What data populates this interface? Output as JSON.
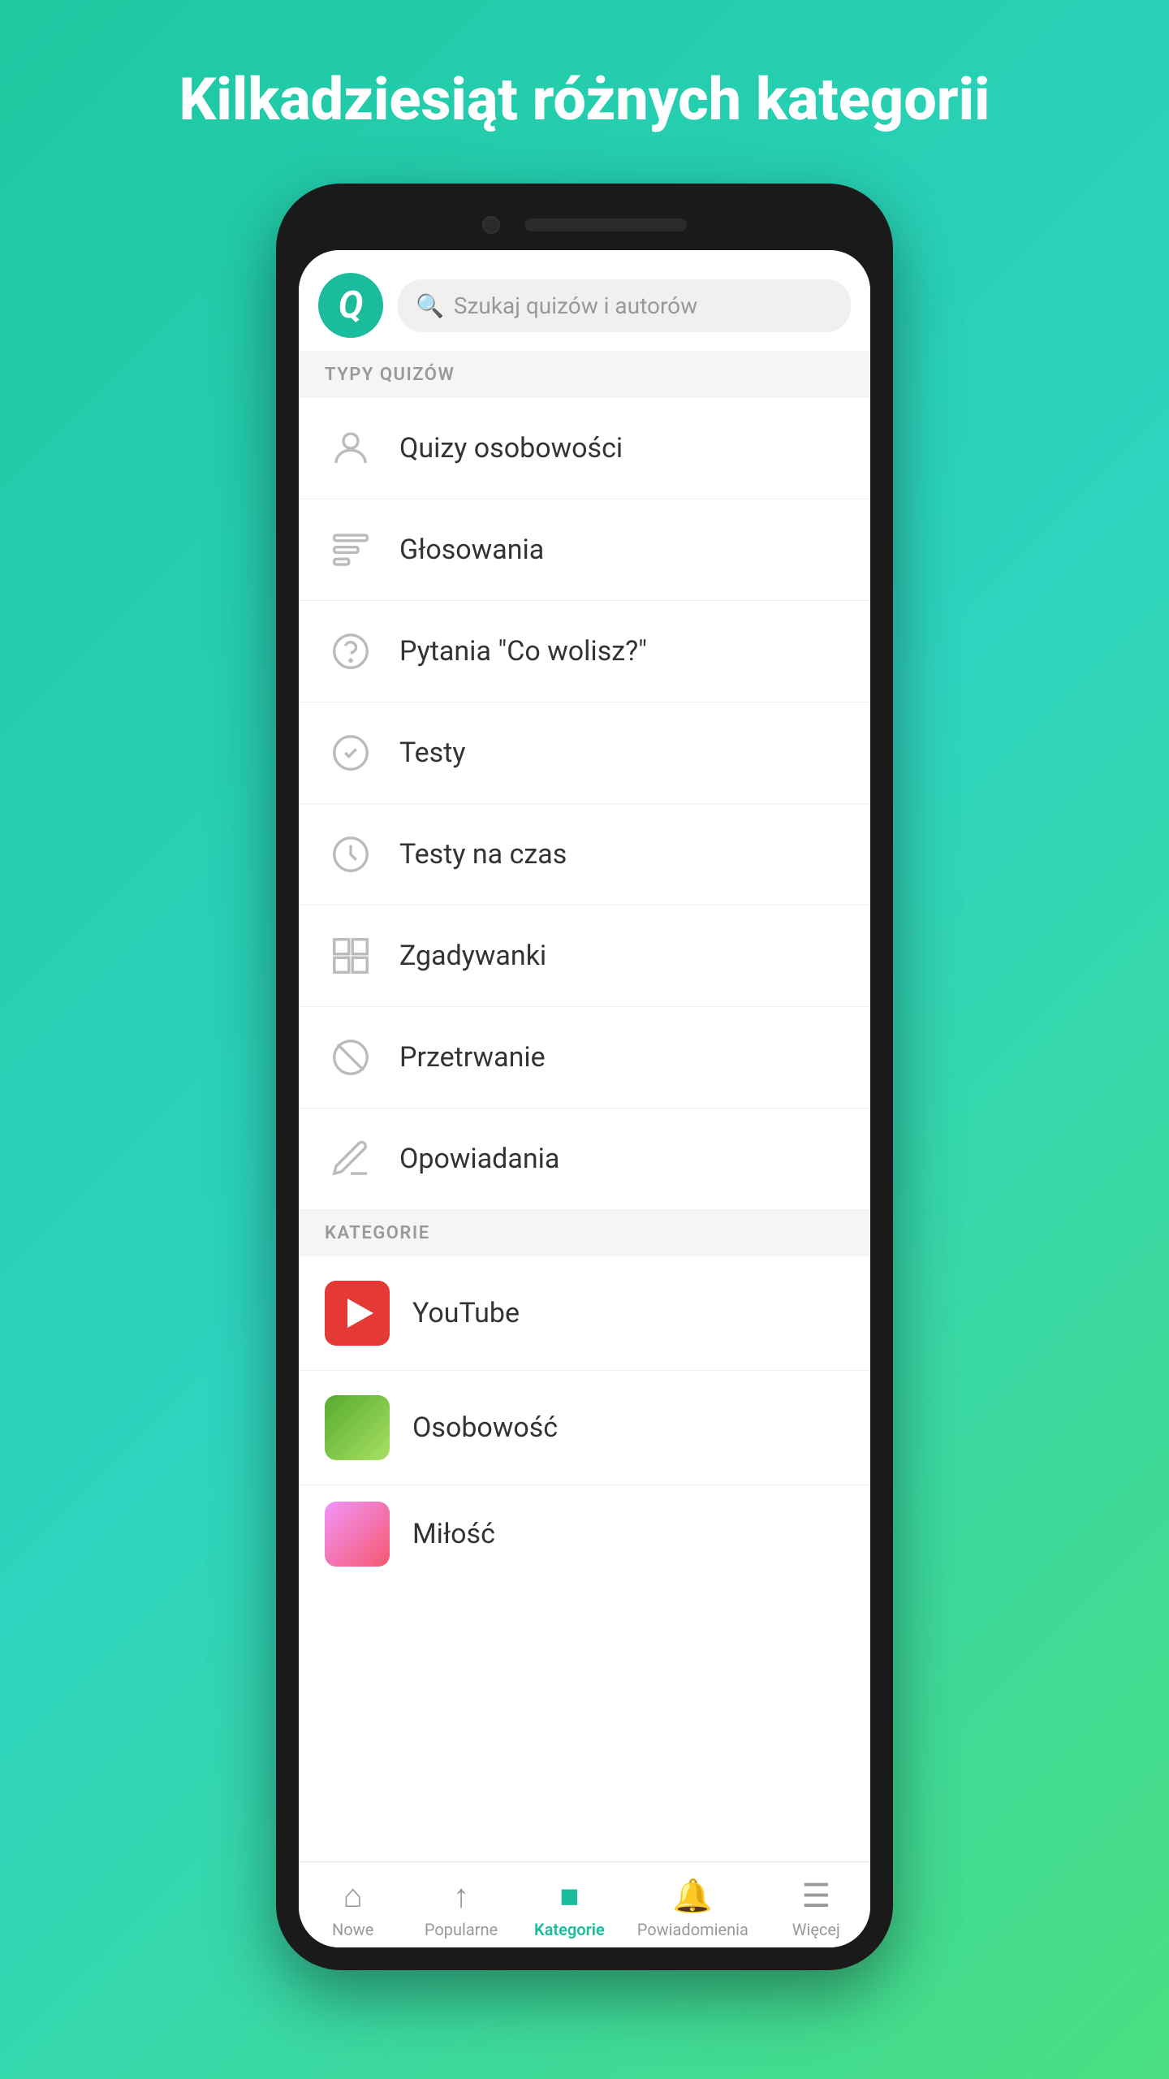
{
  "header": {
    "title": "Kilkadziesiąt różnych kategorii"
  },
  "app": {
    "logo_letter": "Q",
    "search_placeholder": "Szukaj quizów i autorów"
  },
  "sections": {
    "quiz_types": {
      "label": "TYPY QUIZÓW",
      "items": [
        {
          "id": "osobowosci",
          "label": "Quizy osobowości",
          "icon": "person"
        },
        {
          "id": "glosowania",
          "label": "Głosowania",
          "icon": "poll"
        },
        {
          "id": "co-wolisz",
          "label": "Pytania \"Co wolisz?\"",
          "icon": "question"
        },
        {
          "id": "testy",
          "label": "Testy",
          "icon": "checkmark"
        },
        {
          "id": "testy-czas",
          "label": "Testy na czas",
          "icon": "clock"
        },
        {
          "id": "zgadywanki",
          "label": "Zgadywanki",
          "icon": "grid"
        },
        {
          "id": "przetrwanie",
          "label": "Przetrwanie",
          "icon": "ban"
        },
        {
          "id": "opowiadania",
          "label": "Opowiadania",
          "icon": "pen"
        }
      ]
    },
    "categories": {
      "label": "KATEGORIE",
      "items": [
        {
          "id": "youtube",
          "label": "YouTube",
          "icon_type": "youtube"
        },
        {
          "id": "osobowosc",
          "label": "Osobowość",
          "icon_type": "osobowosc"
        },
        {
          "id": "milosc",
          "label": "Miłość",
          "icon_type": "milosc"
        }
      ]
    }
  },
  "bottom_nav": {
    "items": [
      {
        "id": "nowe",
        "label": "Nowe",
        "icon": "home",
        "active": false
      },
      {
        "id": "popularne",
        "label": "Popularne",
        "icon": "trending",
        "active": false
      },
      {
        "id": "kategorie",
        "label": "Kategorie",
        "icon": "grid",
        "active": true
      },
      {
        "id": "powiadomienia",
        "label": "Powiadomienia",
        "icon": "bell",
        "active": false
      },
      {
        "id": "wiecej",
        "label": "Więcej",
        "icon": "menu",
        "active": false
      }
    ]
  },
  "colors": {
    "accent": "#1abc9c",
    "background_start": "#1ec8a0",
    "background_end": "#4ade80",
    "youtube_red": "#e53935",
    "text_dark": "#333333",
    "text_muted": "#999999"
  }
}
